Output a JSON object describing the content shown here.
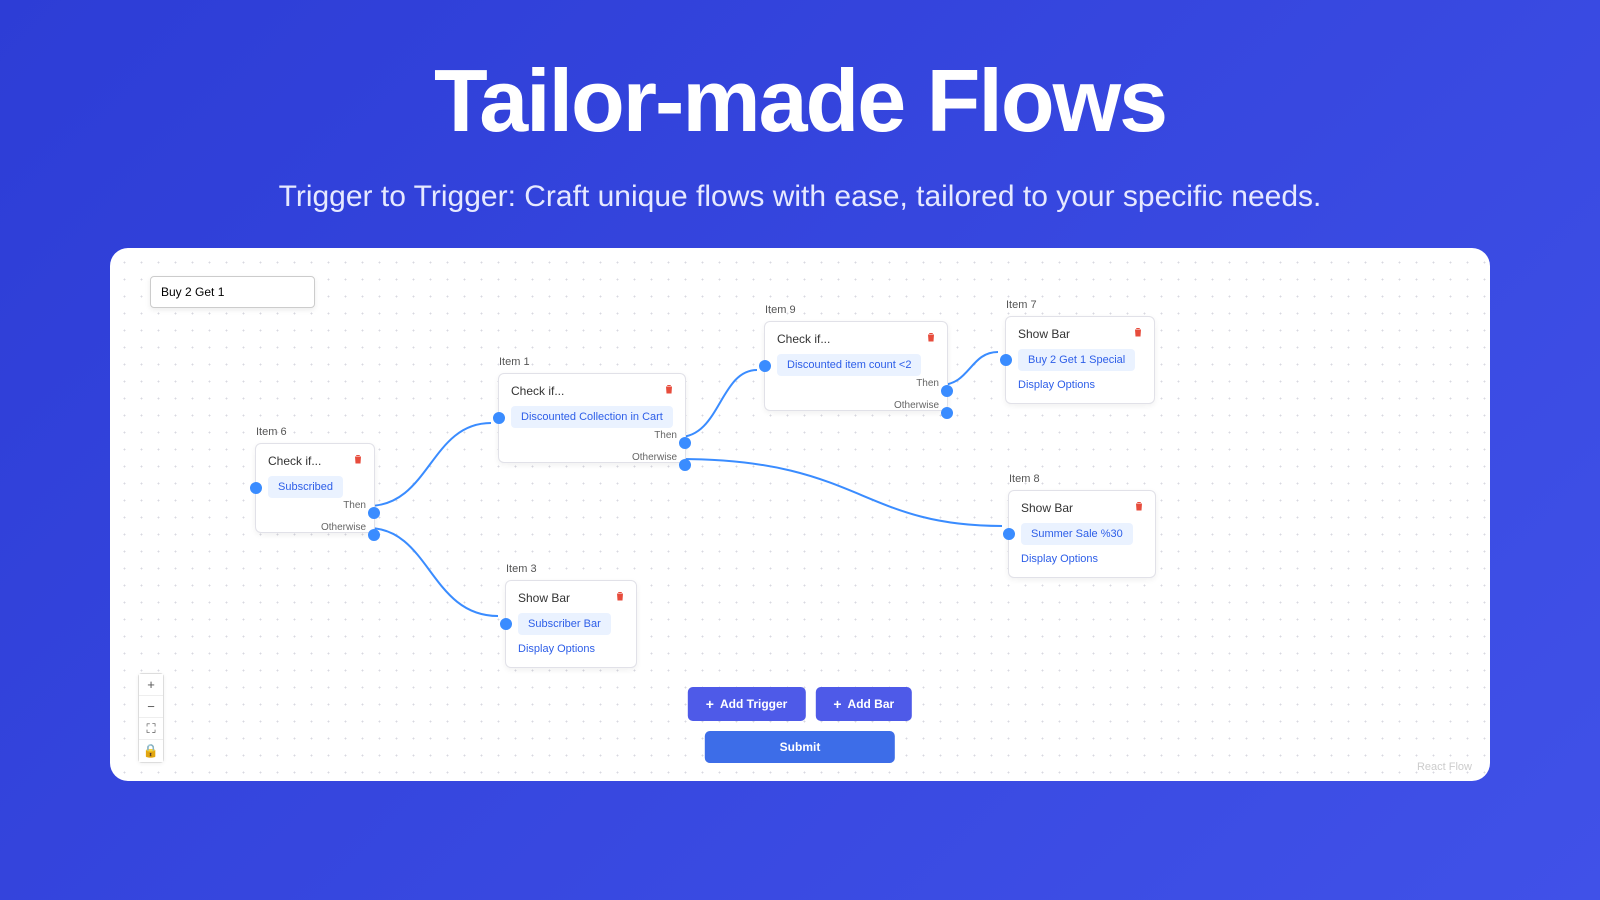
{
  "hero": {
    "title": "Tailor-made Flows",
    "subtitle": "Trigger to Trigger: Craft unique flows with ease, tailored to your specific needs."
  },
  "flow_name": "Buy 2 Get 1",
  "nodes": {
    "item6": {
      "label": "Item 6",
      "title": "Check if...",
      "chip": "Subscribed",
      "then": "Then",
      "otherwise": "Otherwise"
    },
    "item1": {
      "label": "Item 1",
      "title": "Check if...",
      "chip": "Discounted Collection in Cart",
      "then": "Then",
      "otherwise": "Otherwise"
    },
    "item3": {
      "label": "Item 3",
      "title": "Show Bar",
      "chip": "Subscriber Bar",
      "link": "Display Options"
    },
    "item9": {
      "label": "Item 9",
      "title": "Check if...",
      "chip": "Discounted item count <2",
      "then": "Then",
      "otherwise": "Otherwise"
    },
    "item7": {
      "label": "Item 7",
      "title": "Show Bar",
      "chip": "Buy 2 Get 1 Special",
      "link": "Display Options"
    },
    "item8": {
      "label": "Item 8",
      "title": "Show Bar",
      "chip": "Summer Sale %30",
      "link": "Display Options"
    }
  },
  "buttons": {
    "add_trigger": "Add Trigger",
    "add_bar": "Add Bar",
    "submit": "Submit"
  },
  "corner": "React Flow"
}
